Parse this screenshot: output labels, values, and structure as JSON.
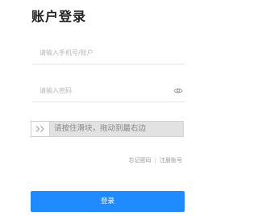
{
  "title": "账户登录",
  "account": {
    "value": "",
    "placeholder": "请输入手机号/账户"
  },
  "password": {
    "value": "",
    "placeholder": "请输入密码",
    "toggle_icon": "eye-icon"
  },
  "slider": {
    "handle_icon": "double-chevron-right-icon",
    "text": "请按住滑块，拖动到最右边"
  },
  "links": {
    "forgot_password": "忘记密码",
    "separator": "|",
    "register": "注册账号"
  },
  "login_button": {
    "label": "登录"
  },
  "colors": {
    "accent": "#1f8bff",
    "slider_bg": "#e2e2e2"
  }
}
